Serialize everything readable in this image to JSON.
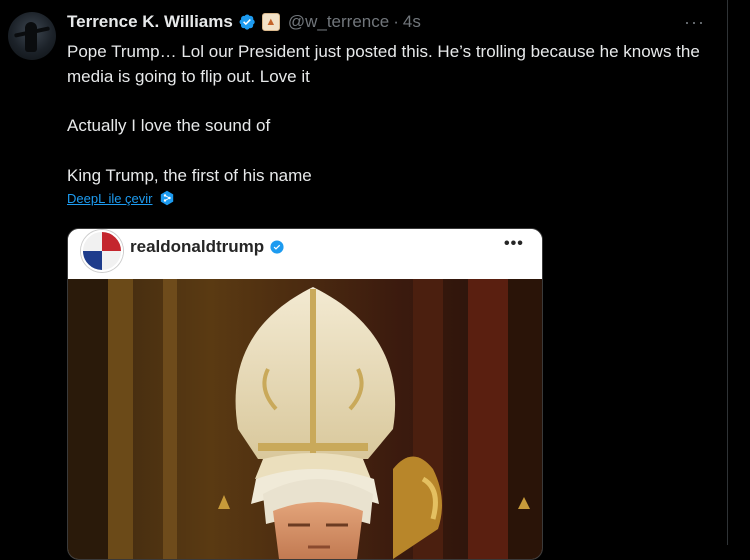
{
  "tweet": {
    "author_name": "Terrence K. Williams",
    "handle": "@w_terrence",
    "separator": "·",
    "time": "4s",
    "more": "···",
    "lines": [
      "Pope Trump… Lol our President just  posted this. He’s trolling because he knows the media is going to flip out.  Love it",
      "Actually I love the sound of",
      "King Trump, the first of his name"
    ],
    "translate_label": "DeepL ile çevir"
  },
  "embed": {
    "username": "realdonaldtrump",
    "more": "•••"
  },
  "colors": {
    "background": "#000000",
    "text": "#e7e9ea",
    "muted": "#71767b",
    "link": "#1d9bf0",
    "verified": "#1d9bf0"
  },
  "icons": {
    "verified": "verified-badge-icon",
    "profile_emoji": "cat-emoji-icon",
    "more": "more-dots-icon",
    "translate": "deepl-icon"
  }
}
